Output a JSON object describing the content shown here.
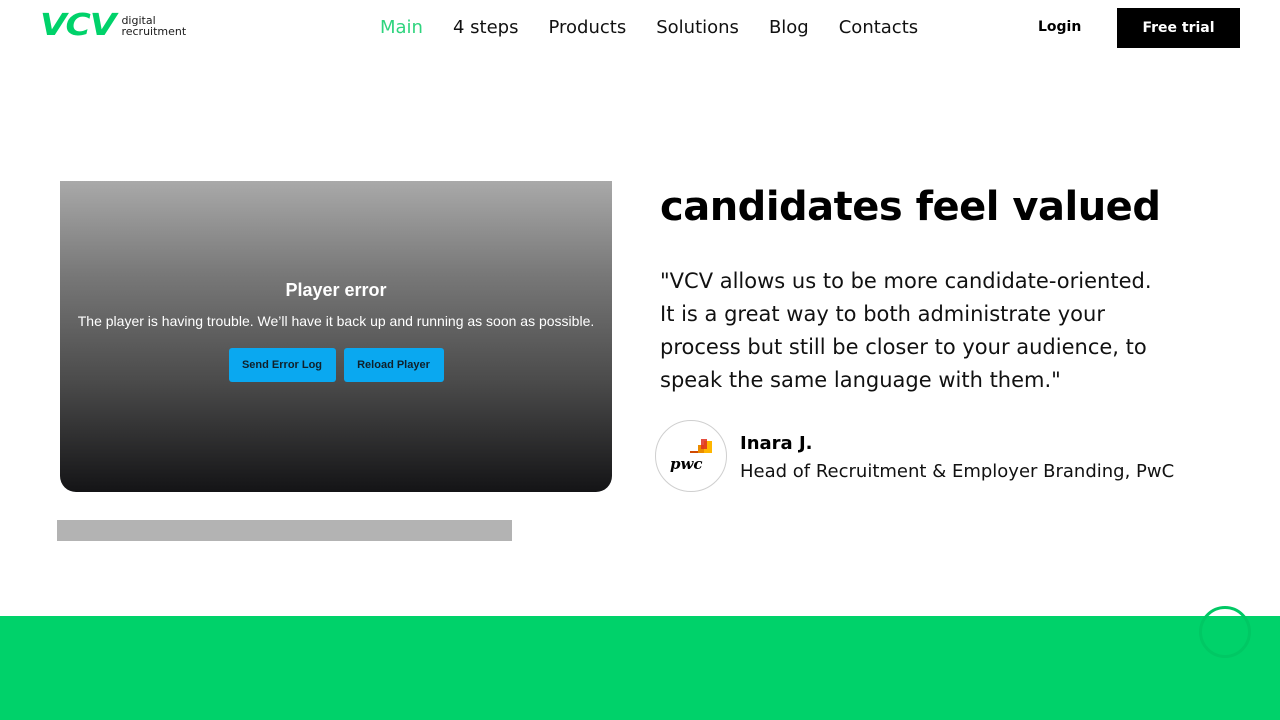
{
  "header": {
    "logo_mark": "VCV",
    "logo_line1": "digital",
    "logo_line2": "recruitment",
    "nav": [
      {
        "label": "Main",
        "active": true
      },
      {
        "label": "4 steps"
      },
      {
        "label": "Products"
      },
      {
        "label": "Solutions"
      },
      {
        "label": "Blog"
      },
      {
        "label": "Contacts"
      }
    ],
    "login_label": "Login",
    "trial_label": "Free trial"
  },
  "player": {
    "title": "Player error",
    "message": "The player is having trouble. We’ll have it back up and running as soon as possible.",
    "send_label": "Send Error Log",
    "reload_label": "Reload Player"
  },
  "testimonial": {
    "heading": "candidates feel valued",
    "quote": "\"VCV allows us to be more candidate-oriented. It is a great way to both administrate your process but still be closer to your audience, to speak the same language with them.\"",
    "company_logo_text": "pwc",
    "person_name": "Inara J.",
    "person_role": "Head of Recruitment & Employer Branding, PwC"
  },
  "colors": {
    "brand_green": "#00d26a",
    "nav_active": "#2fd47e",
    "player_button": "#0aa8f0"
  }
}
